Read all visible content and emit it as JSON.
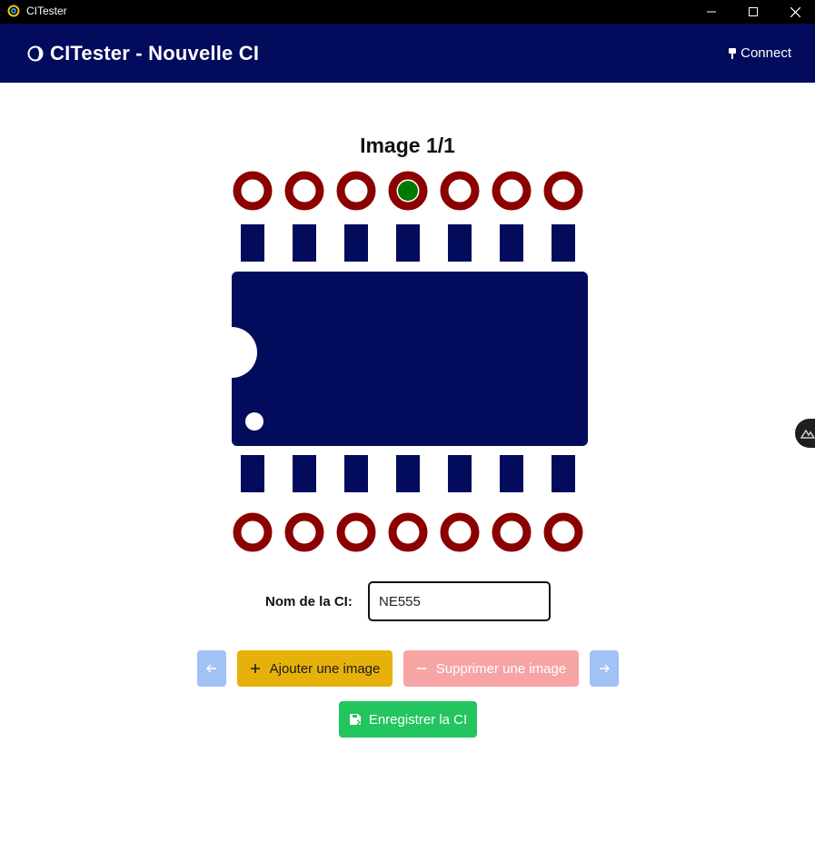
{
  "window": {
    "title": "CITester",
    "icons": {
      "app": "app-logo-icon",
      "minimize": "minimize-icon",
      "maximize": "maximize-icon",
      "close": "close-icon"
    }
  },
  "header": {
    "title": "CITester - Nouvelle CI",
    "logo_icon": "moon-logo-icon",
    "connect_label": "Connect",
    "connect_icon": "plug-icon",
    "background": "#020b5c"
  },
  "editor": {
    "image_title": "Image 1/1",
    "chip": {
      "pins_per_side": 7,
      "body_color": "#020b5c",
      "pad_color": "#8b0000",
      "selected_color": "#007a00",
      "selected_top_pin": 4
    }
  },
  "form": {
    "name_label": "Nom de la CI:",
    "name_value": "NE555"
  },
  "buttons": {
    "prev_icon": "arrow-left-icon",
    "add_label": "Ajouter une image",
    "add_icon": "plus-icon",
    "delete_label": "Supprimer une image",
    "delete_icon": "minus-icon",
    "next_icon": "arrow-right-icon",
    "save_label": "Enregistrer la CI",
    "save_icon": "save-icon"
  },
  "colors": {
    "add": "#e7b10b",
    "delete": "#f7a4a5",
    "nav": "#a2c1f4",
    "save": "#22c55e"
  }
}
